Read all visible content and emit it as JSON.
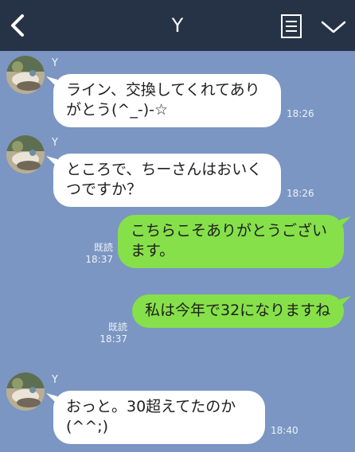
{
  "header": {
    "title": "Y",
    "back_icon": "chevron-left-icon",
    "notes_icon": "notes-list-icon",
    "menu_icon": "chevron-down-icon"
  },
  "colors": {
    "header_bg": "#263347",
    "chat_bg": "#7b96c2",
    "incoming_bubble": "#ffffff",
    "outgoing_bubble": "#86e04a"
  },
  "messages": [
    {
      "direction": "incoming",
      "sender": "Y",
      "text": "ライン、交換してくれてありがとう(^_-)-☆",
      "time": "18:26"
    },
    {
      "direction": "incoming",
      "sender": "Y",
      "text": "ところで、ちーさんはおいくつですか？",
      "time": "18:26"
    },
    {
      "direction": "outgoing",
      "text": "こちらこそありがとうございます。",
      "read": "既読",
      "time": "18:37"
    },
    {
      "direction": "outgoing",
      "text": "私は今年で32になりますね",
      "read": "既読",
      "time": "18:37"
    },
    {
      "direction": "incoming",
      "sender": "Y",
      "text": "おっと。30超えてたのか(^^;)",
      "time": "18:40"
    }
  ]
}
